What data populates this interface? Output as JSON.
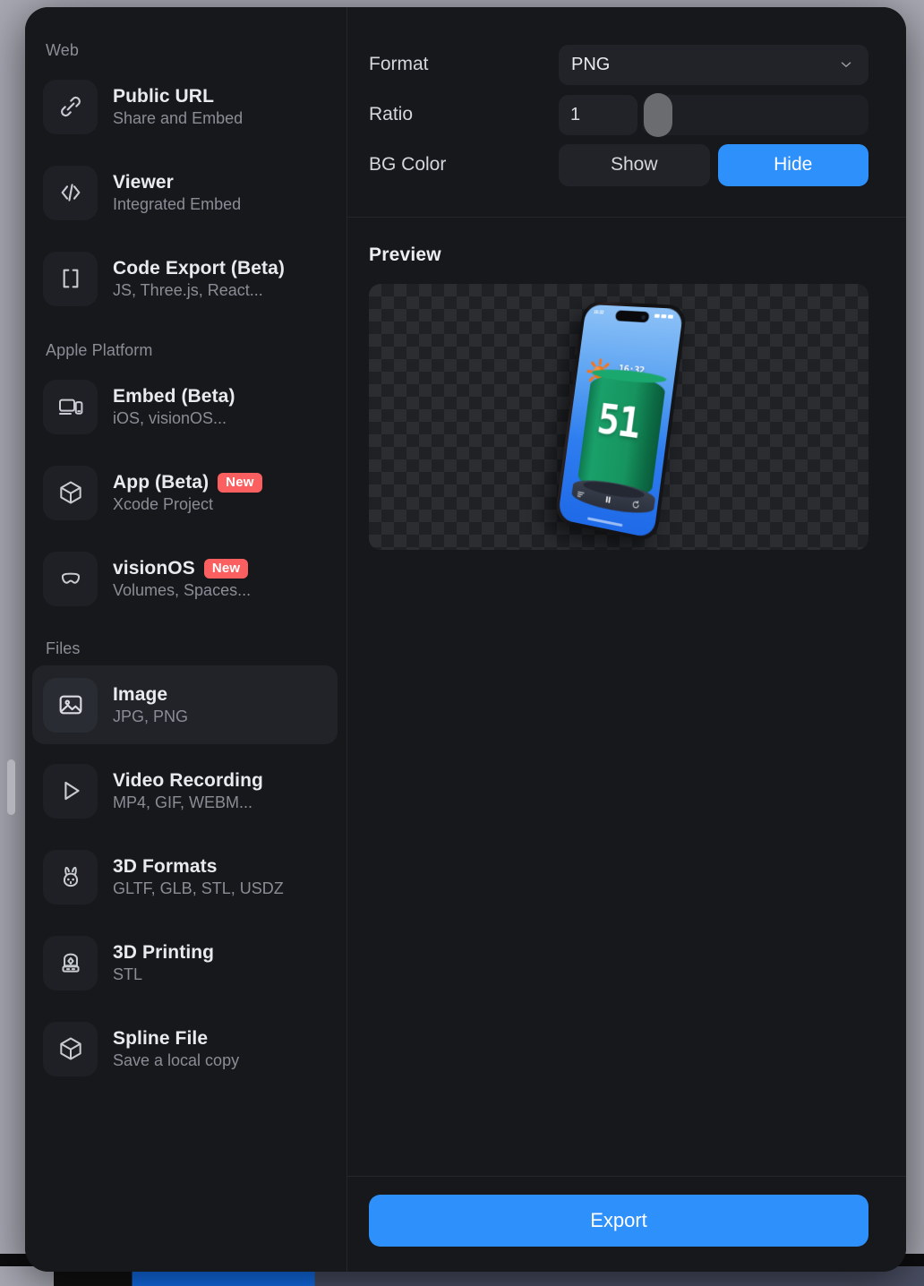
{
  "sidebar": {
    "sections": [
      {
        "label": "Web",
        "items": [
          {
            "icon": "link-icon",
            "title": "Public URL",
            "subtitle": "Share and Embed",
            "badge": null,
            "selected": false
          },
          {
            "icon": "code-icon",
            "title": "Viewer",
            "subtitle": "Integrated Embed",
            "badge": null,
            "selected": false
          },
          {
            "icon": "brackets-icon",
            "title": "Code Export (Beta)",
            "subtitle": "JS, Three.js, React...",
            "badge": null,
            "selected": false
          }
        ]
      },
      {
        "label": "Apple Platform",
        "items": [
          {
            "icon": "devices-icon",
            "title": "Embed (Beta)",
            "subtitle": "iOS, visionOS...",
            "badge": null,
            "selected": false
          },
          {
            "icon": "cube-icon",
            "title": "App (Beta)",
            "subtitle": "Xcode Project",
            "badge": "New",
            "selected": false
          },
          {
            "icon": "headset-icon",
            "title": "visionOS",
            "subtitle": "Volumes, Spaces...",
            "badge": "New",
            "selected": false
          }
        ]
      },
      {
        "label": "Files",
        "items": [
          {
            "icon": "image-icon",
            "title": "Image",
            "subtitle": "JPG, PNG",
            "badge": null,
            "selected": true
          },
          {
            "icon": "play-icon",
            "title": "Video Recording",
            "subtitle": "MP4, GIF, WEBM...",
            "badge": null,
            "selected": false
          },
          {
            "icon": "rabbit-icon",
            "title": "3D Formats",
            "subtitle": "GLTF, GLB, STL, USDZ",
            "badge": null,
            "selected": false
          },
          {
            "icon": "printer-icon",
            "title": "3D Printing",
            "subtitle": "STL",
            "badge": null,
            "selected": false
          },
          {
            "icon": "cube-icon",
            "title": "Spline File",
            "subtitle": "Save a local copy",
            "badge": null,
            "selected": false
          }
        ]
      }
    ]
  },
  "settings": {
    "format": {
      "label": "Format",
      "value": "PNG",
      "chevron": "chevron-down-icon"
    },
    "ratio": {
      "label": "Ratio",
      "value": "1",
      "slider_percent": 3
    },
    "bg_color": {
      "label": "BG Color",
      "options": [
        {
          "label": "Show",
          "active": false
        },
        {
          "label": "Hide",
          "active": true
        }
      ]
    }
  },
  "preview": {
    "title": "Preview",
    "scene": {
      "status_time": "16:32",
      "timer_display": "16:32",
      "counter_value": "51",
      "controls": [
        "list-icon",
        "pause-icon",
        "reset-icon"
      ],
      "sun_icon": "sun-icon"
    }
  },
  "footer": {
    "export_label": "Export"
  },
  "colors": {
    "accent_blue": "#2e90fa",
    "badge_red": "#fb5f5f",
    "panel_bg": "#17181c",
    "tile_bg": "#1e2025",
    "selected_row": "#212329",
    "backdrop": "#a8a8b3"
  }
}
